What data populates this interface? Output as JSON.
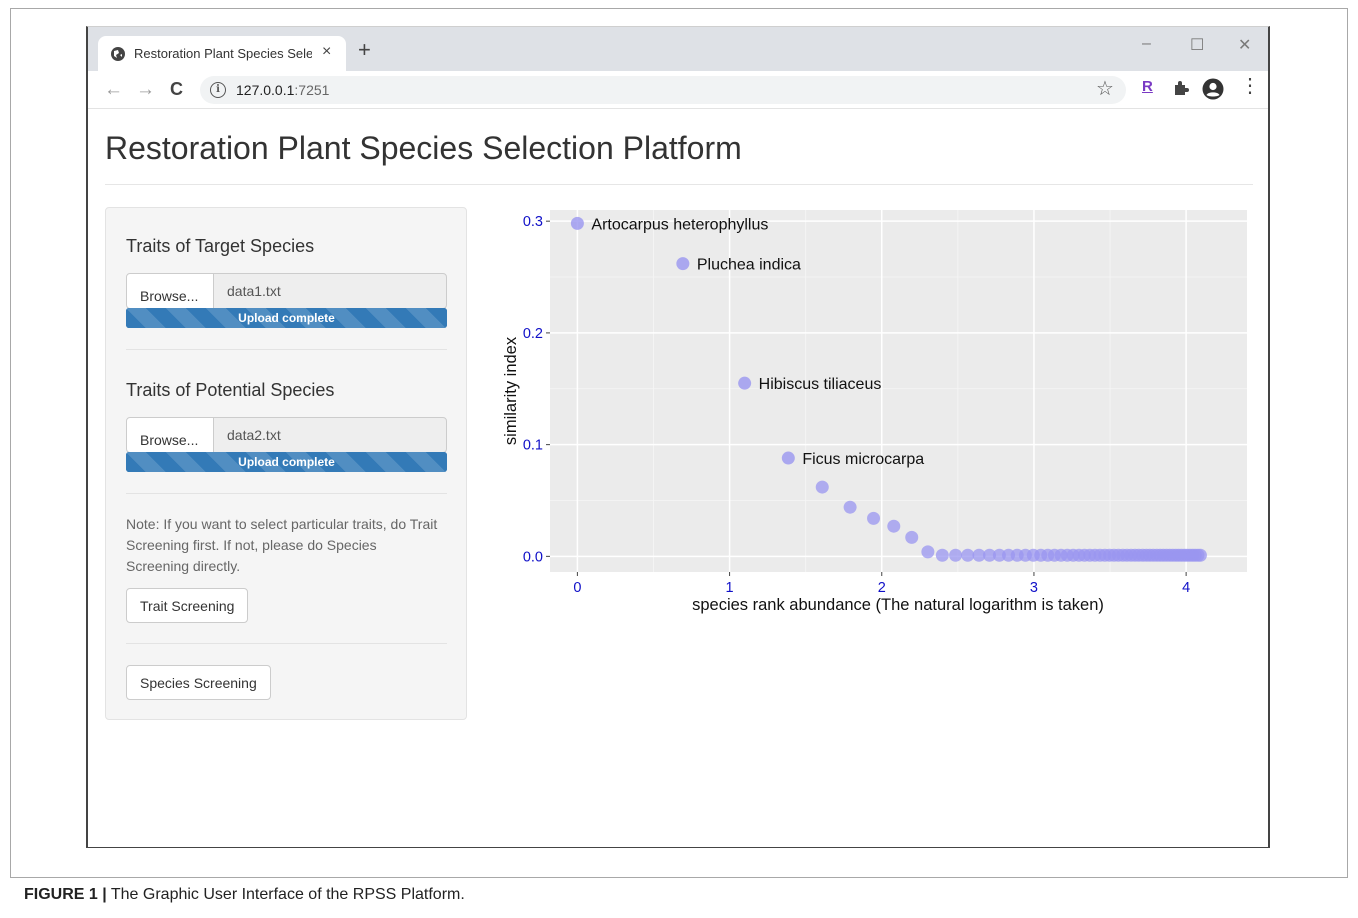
{
  "browser": {
    "tab_title": "Restoration Plant Species Sele",
    "tab_close": "×",
    "new_tab": "+",
    "window_controls": {
      "minimize": "–",
      "maximize": "☐",
      "close": "✕"
    },
    "nav": {
      "back": "←",
      "forward": "→",
      "reload": "C"
    },
    "url_host": "127.0.0.1",
    "url_port": ":7251",
    "info_glyph": "i",
    "star_glyph": "☆",
    "extension_label": "R",
    "menu_glyph": "⋮"
  },
  "page": {
    "title": "Restoration Plant Species Selection Platform"
  },
  "sidebar": {
    "target": {
      "label": "Traits of Target Species",
      "browse_label": "Browse...",
      "file_name": "data1.txt",
      "progress_text": "Upload complete",
      "progress": 1.0
    },
    "potential": {
      "label": "Traits of Potential Species",
      "browse_label": "Browse...",
      "file_name": "data2.txt",
      "progress_text": "Upload complete",
      "progress": 1.0
    },
    "note": "Note: If you want to select particular traits, do Trait Screening first. If not, please do Species Screening directly.",
    "trait_button": "Trait Screening",
    "species_button": "Species Screening"
  },
  "chart_data": {
    "type": "scatter",
    "xlabel": "species rank abundance (The natural logarithm is taken)",
    "ylabel": "similarity index",
    "xlim": [
      -0.18,
      4.4
    ],
    "ylim": [
      -0.014,
      0.31
    ],
    "xticks": [
      0,
      1,
      2,
      3,
      4
    ],
    "yticks": [
      0.0,
      0.1,
      0.2,
      0.3
    ],
    "ytick_labels": [
      "0.0",
      "0.1",
      "0.2",
      "0.3"
    ],
    "grid": true,
    "point_color": "#9a96f0",
    "tick_color": "#1010c8",
    "panel_color": "#ebebeb",
    "labelled_points": [
      {
        "label": "Artocarpus heterophyllus",
        "x": 0.0,
        "y": 0.298
      },
      {
        "label": "Pluchea indica",
        "x": 0.693,
        "y": 0.262
      },
      {
        "label": "Hibiscus tiliaceus",
        "x": 1.099,
        "y": 0.155
      },
      {
        "label": "Ficus microcarpa",
        "x": 1.386,
        "y": 0.088
      }
    ],
    "x": [
      1.609,
      1.792,
      1.946,
      2.079,
      2.197,
      2.303,
      2.398,
      2.485,
      2.565,
      2.639,
      2.708,
      2.773,
      2.833,
      2.89,
      2.944,
      2.996,
      3.045,
      3.091,
      3.135,
      3.178,
      3.219,
      3.258,
      3.296,
      3.332,
      3.367,
      3.401,
      3.434,
      3.466,
      3.497,
      3.526,
      3.555,
      3.584,
      3.611,
      3.638,
      3.664,
      3.689,
      3.714,
      3.738,
      3.761,
      3.784,
      3.807,
      3.829,
      3.85,
      3.871,
      3.892,
      3.912,
      3.932,
      3.951,
      3.97,
      3.989,
      4.007,
      4.025,
      4.043,
      4.06,
      4.078,
      4.094
    ],
    "y": [
      0.062,
      0.044,
      0.034,
      0.027,
      0.017,
      0.004,
      0.001,
      0.001,
      0.001,
      0.001,
      0.001,
      0.001,
      0.001,
      0.001,
      0.001,
      0.001,
      0.001,
      0.001,
      0.001,
      0.001,
      0.001,
      0.001,
      0.001,
      0.001,
      0.001,
      0.001,
      0.001,
      0.001,
      0.001,
      0.001,
      0.001,
      0.001,
      0.001,
      0.001,
      0.001,
      0.001,
      0.001,
      0.001,
      0.001,
      0.001,
      0.001,
      0.001,
      0.001,
      0.001,
      0.001,
      0.001,
      0.001,
      0.001,
      0.001,
      0.001,
      0.001,
      0.001,
      0.001,
      0.001,
      0.001,
      0.001
    ]
  },
  "caption": {
    "prefix": "FIGURE 1 |",
    "text": " The Graphic User Interface of the RPSS Platform."
  }
}
